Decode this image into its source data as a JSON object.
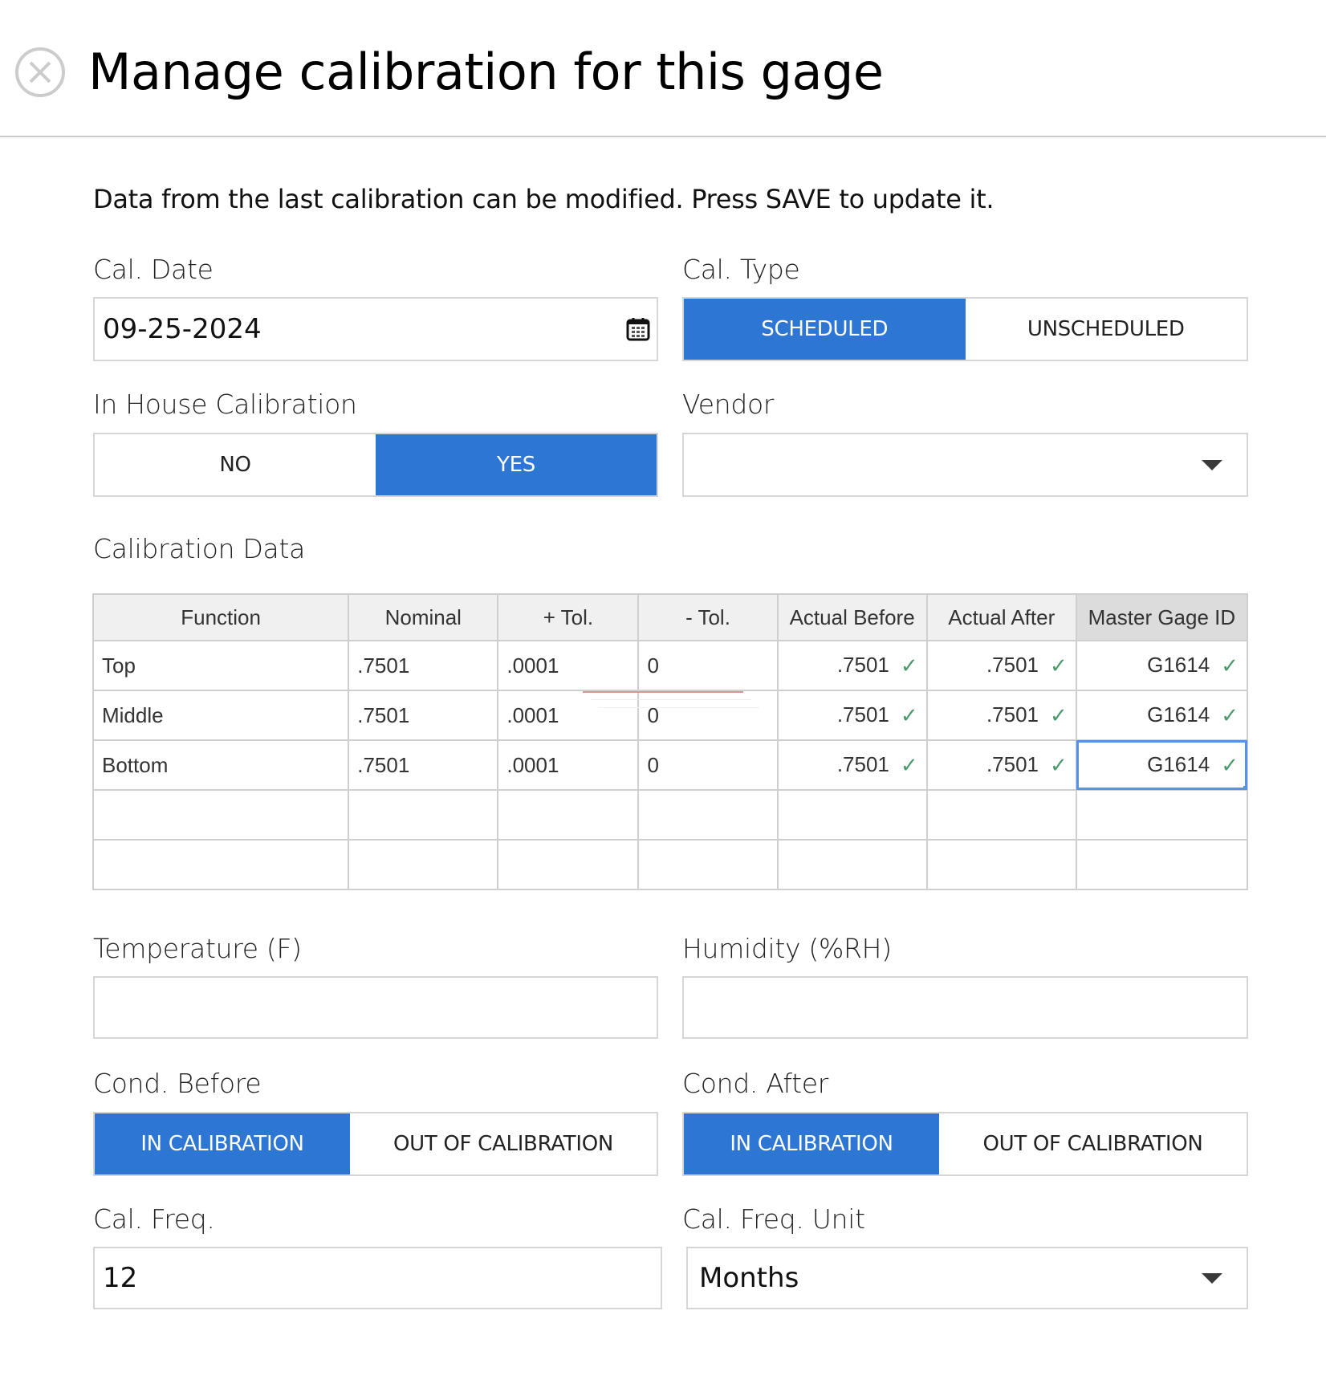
{
  "dialog": {
    "title": "Manage calibration for this gage",
    "close_icon": "circle-x-icon",
    "intro": "Data from the last calibration can be modified. Press SAVE to update it."
  },
  "cal_date": {
    "label": "Cal. Date",
    "value": "09-25-2024",
    "icon": "calendar-icon"
  },
  "cal_type": {
    "label": "Cal. Type",
    "options": [
      "SCHEDULED",
      "UNSCHEDULED"
    ],
    "selected": "SCHEDULED"
  },
  "in_house": {
    "label": "In House Calibration",
    "options": [
      "NO",
      "YES"
    ],
    "selected": "YES"
  },
  "vendor": {
    "label": "Vendor",
    "value": "",
    "icon": "dropdown-caret-icon"
  },
  "calibration_data": {
    "label": "Calibration Data",
    "columns": [
      "Function",
      "Nominal",
      "+ Tol.",
      "- Tol.",
      "Actual Before",
      "Actual After",
      "Master Gage ID"
    ],
    "rows": [
      {
        "function": "Top",
        "nominal": ".7501",
        "plus_tol": ".0001",
        "minus_tol": "0",
        "actual_before": ".7501",
        "actual_after": ".7501",
        "master_gage_id": "G1614"
      },
      {
        "function": "Middle",
        "nominal": ".7501",
        "plus_tol": ".0001",
        "minus_tol": "0",
        "actual_before": ".7501",
        "actual_after": ".7501",
        "master_gage_id": "G1614"
      },
      {
        "function": "Bottom",
        "nominal": ".7501",
        "plus_tol": ".0001",
        "minus_tol": "0",
        "actual_before": ".7501",
        "actual_after": ".7501",
        "master_gage_id": "G1614"
      },
      {
        "function": "",
        "nominal": "",
        "plus_tol": "",
        "minus_tol": "",
        "actual_before": "",
        "actual_after": "",
        "master_gage_id": ""
      },
      {
        "function": "",
        "nominal": "",
        "plus_tol": "",
        "minus_tol": "",
        "actual_before": "",
        "actual_after": "",
        "master_gage_id": ""
      }
    ],
    "check_icon": "✓",
    "selected_cell": "Bottom / Master Gage ID"
  },
  "temperature": {
    "label": "Temperature (F)",
    "value": ""
  },
  "humidity": {
    "label": "Humidity (%RH)",
    "value": ""
  },
  "cond_before": {
    "label": "Cond. Before",
    "options": [
      "IN CALIBRATION",
      "OUT OF CALIBRATION"
    ],
    "selected": "IN CALIBRATION"
  },
  "cond_after": {
    "label": "Cond. After",
    "options": [
      "IN CALIBRATION",
      "OUT OF CALIBRATION"
    ],
    "selected": "IN CALIBRATION"
  },
  "cal_freq": {
    "label": "Cal. Freq.",
    "value": "12"
  },
  "cal_freq_unit": {
    "label": "Cal. Freq. Unit",
    "value": "Months"
  },
  "colors": {
    "accent": "#2e76d4",
    "check": "#4a9a6c",
    "selection": "#5a8ff0",
    "border": "#d6d6d6"
  }
}
